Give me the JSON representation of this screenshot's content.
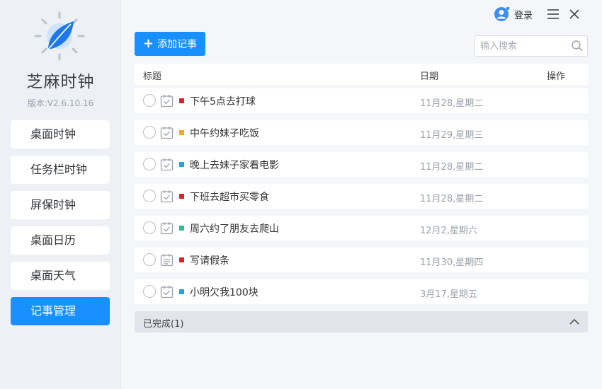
{
  "app": {
    "title": "芝麻时钟",
    "version": "版本:V2.6.10.16"
  },
  "sidebar": {
    "items": [
      {
        "label": "桌面时钟",
        "active": false
      },
      {
        "label": "任务栏时钟",
        "active": false
      },
      {
        "label": "屏保时钟",
        "active": false
      },
      {
        "label": "桌面日历",
        "active": false
      },
      {
        "label": "桌面天气",
        "active": false
      },
      {
        "label": "记事管理",
        "active": true
      }
    ]
  },
  "titlebar": {
    "login_label": "登录"
  },
  "toolbar": {
    "add_label": "添加记事",
    "search_placeholder": "输入搜索"
  },
  "table": {
    "columns": {
      "title": "标题",
      "date": "日期",
      "action": "操作"
    },
    "rows": [
      {
        "title": "下午5点去打球",
        "date": "11月28,星期二",
        "color": "#e02020",
        "icon": "calendar-check-icon"
      },
      {
        "title": "中午约妹子吃饭",
        "date": "11月29,星期三",
        "color": "#f5a623",
        "icon": "calendar-check-icon"
      },
      {
        "title": "晚上去妹子家看电影",
        "date": "11月28,星期二",
        "color": "#1aa7e0",
        "icon": "calendar-check-icon"
      },
      {
        "title": "下班去超市买零食",
        "date": "11月28,星期二",
        "color": "#e02020",
        "icon": "calendar-check-icon"
      },
      {
        "title": "周六约了朋友去爬山",
        "date": "12月2,星期六",
        "color": "#21c28e",
        "icon": "calendar-check-icon"
      },
      {
        "title": "写请假条",
        "date": "11月30,星期四",
        "color": "#e02020",
        "icon": "calendar-list-icon"
      },
      {
        "title": "小明欠我100块",
        "date": "3月17,星期五",
        "color": "#1aa7e0",
        "icon": "calendar-check-icon"
      }
    ]
  },
  "completed": {
    "label": "已完成(1)"
  },
  "colors": {
    "accent": "#1890ff"
  }
}
